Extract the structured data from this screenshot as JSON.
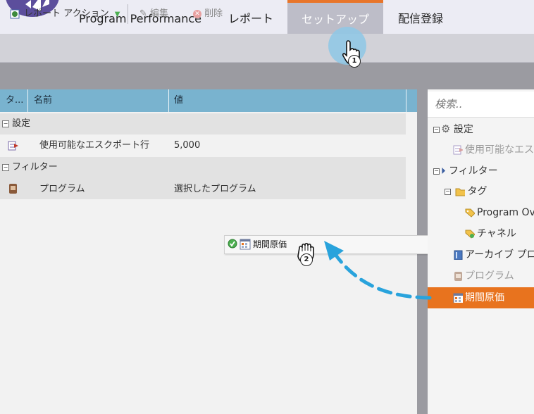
{
  "nav": {
    "tabs": [
      {
        "label": "Program Performance"
      },
      {
        "label": "レポート"
      },
      {
        "label": "セットアップ"
      },
      {
        "label": "配信登録"
      }
    ]
  },
  "toolbar": {
    "report_actions_label": "レポート アクション",
    "edit_label": "編集",
    "delete_label": "削除"
  },
  "grid": {
    "columns": [
      "タ...",
      "名前",
      "値"
    ],
    "groups": [
      {
        "label": "設定",
        "rows": [
          {
            "name": "使用可能なエスクポート行",
            "value": "5,000"
          }
        ]
      },
      {
        "label": "フィルター",
        "rows": [
          {
            "name": "プログラム",
            "value": "選択したプログラム"
          }
        ]
      }
    ]
  },
  "drag_ghost": {
    "label": "期間原価"
  },
  "tree": {
    "search_placeholder": "検索..",
    "nodes": [
      {
        "label": "設定"
      },
      {
        "label": "使用可能なエス"
      },
      {
        "label": "フィルター"
      },
      {
        "label": "タグ"
      },
      {
        "label": "Program Ov"
      },
      {
        "label": "チャネル"
      },
      {
        "label": "アーカイブ プロ"
      },
      {
        "label": "プログラム"
      },
      {
        "label": "期間原価"
      }
    ]
  },
  "cursors": {
    "step1": "1",
    "step2": "2"
  },
  "colors": {
    "accent": "#e8731e",
    "grid_header": "#79b3cf",
    "brand": "#5c4e9c",
    "arrow": "#29a3dc"
  }
}
